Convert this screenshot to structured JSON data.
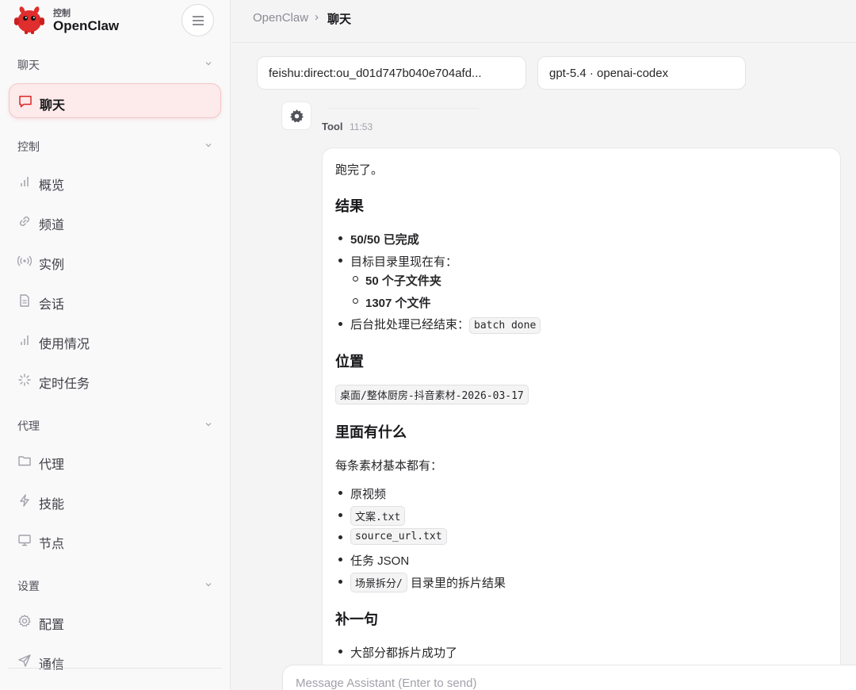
{
  "brand": {
    "sub": "控制",
    "name": "OpenClaw"
  },
  "sidebar": {
    "groups": [
      {
        "label": "聊天",
        "items": [
          {
            "label": "聊天",
            "icon": "chat-bubble-icon",
            "active": true
          }
        ]
      },
      {
        "label": "控制",
        "items": [
          {
            "label": "概览",
            "icon": "bar-chart-icon"
          },
          {
            "label": "频道",
            "icon": "link-icon"
          },
          {
            "label": "实例",
            "icon": "radio-broadcast-icon"
          },
          {
            "label": "会话",
            "icon": "document-icon"
          },
          {
            "label": "使用情况",
            "icon": "bar-chart-icon"
          },
          {
            "label": "定时任务",
            "icon": "loader-icon"
          }
        ]
      },
      {
        "label": "代理",
        "items": [
          {
            "label": "代理",
            "icon": "folder-icon"
          },
          {
            "label": "技能",
            "icon": "lightning-icon"
          },
          {
            "label": "节点",
            "icon": "monitor-icon"
          }
        ]
      },
      {
        "label": "设置",
        "items": [
          {
            "label": "配置",
            "icon": "gear-icon"
          },
          {
            "label": "通信",
            "icon": "send-icon"
          }
        ]
      }
    ]
  },
  "breadcrumb": {
    "root": "OpenClaw",
    "separator": "›",
    "current": "聊天"
  },
  "session_selector": {
    "value": "feishu:direct:ou_d01d747b040e704afd..."
  },
  "model_selector": {
    "value": "gpt-5.4 · openai-codex"
  },
  "tool_message": {
    "sender": "Tool",
    "time": "11:53",
    "icon": "gear-icon"
  },
  "message": {
    "intro": "跑完了。",
    "result_heading": "结果",
    "result_items": {
      "done": "50/50 已完成",
      "target_dir": "目标目录里现在有：",
      "subfolders": "50 个子文件夹",
      "files": "1307 个文件",
      "batch_prefix": "后台批处理已经结束：",
      "batch_code": "batch done"
    },
    "location_heading": "位置",
    "location_code": "桌面/整体厨房-抖音素材-2026-03-17",
    "contents_heading": "里面有什么",
    "contents_intro": "每条素材基本都有：",
    "contents_items": {
      "video": "原视频",
      "copy_code": "文案.txt",
      "url_code": "source_url.txt",
      "task_json": "任务 JSON",
      "scenes_code": "场景拆分/",
      "scenes_suffix": "目录里的拆片结果"
    },
    "extra_heading": "补一句",
    "extra_items": {
      "split": "大部分都拆片成功了"
    }
  },
  "composer": {
    "placeholder": "Message Assistant (Enter to send)"
  },
  "colors": {
    "accent": "#dc2626",
    "active_bg": "#fdeaea"
  }
}
